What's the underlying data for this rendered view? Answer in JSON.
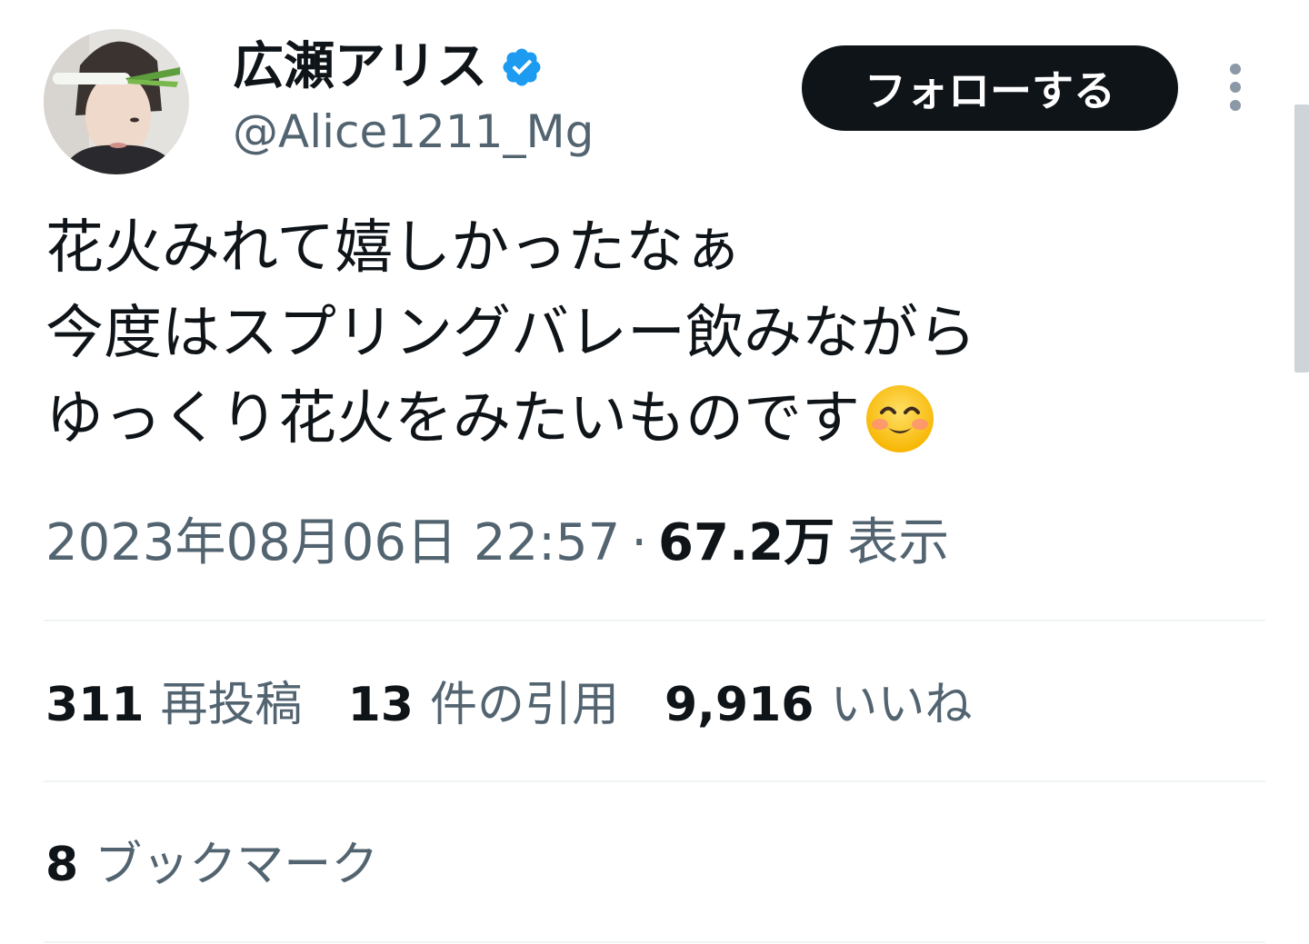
{
  "author": {
    "display_name": "広瀬アリス",
    "handle": "@Alice1211_Mg",
    "verified_icon": "verified-badge-icon",
    "avatar_icon": "profile-avatar"
  },
  "follow_button": {
    "label": "フォローする"
  },
  "more_button": {
    "icon": "more-vertical-icon"
  },
  "tweet": {
    "lines": [
      "花火みれて嬉しかったなぁ",
      "今度はスプリングバレー飲みながら",
      "ゆっくり花火をみたいものです"
    ],
    "emoji": "smiling-face-emoji"
  },
  "meta": {
    "timestamp": "2023年08月06日 22:57",
    "separator": "·",
    "views_count": "67.2万",
    "views_label": "表示"
  },
  "stats": [
    {
      "count": "311",
      "label": "再投稿"
    },
    {
      "count": "13",
      "label": "件の引用"
    },
    {
      "count": "9,916",
      "label": "いいね"
    }
  ],
  "bookmarks": {
    "count": "8",
    "label": "ブックマーク"
  },
  "colors": {
    "text_primary": "#0f1419",
    "text_secondary": "#536471",
    "verified_blue": "#1d9bf0",
    "divider": "#eff3f4",
    "button_bg": "#0f1419"
  }
}
